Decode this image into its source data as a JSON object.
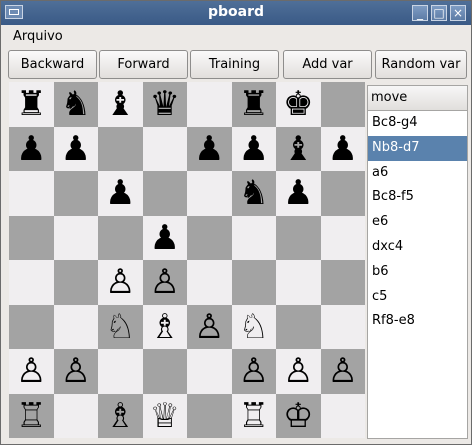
{
  "window": {
    "title": "pboard"
  },
  "menu": {
    "items": [
      "Arquivo"
    ]
  },
  "toolbar": {
    "buttons": [
      "Backward",
      "Forward",
      "Training",
      "Add var",
      "Random var"
    ]
  },
  "board": {
    "light_color": "#f0eef0",
    "dark_color": "#a3a3a3",
    "pieces": [
      [
        "♜",
        "♞",
        "♝",
        "♛",
        "",
        "♜",
        "♚",
        ""
      ],
      [
        "♟",
        "♟",
        "",
        "",
        "♟",
        "♟",
        "♝",
        "♟"
      ],
      [
        "",
        "",
        "♟",
        "",
        "",
        "♞",
        "♟",
        ""
      ],
      [
        "",
        "",
        "",
        "♟",
        "",
        "",
        "",
        ""
      ],
      [
        "",
        "",
        "♙",
        "♙",
        "",
        "",
        "",
        ""
      ],
      [
        "",
        "",
        "♘",
        "♗",
        "♙",
        "♘",
        "",
        ""
      ],
      [
        "♙",
        "♙",
        "",
        "",
        "",
        "♙",
        "♙",
        "♙"
      ],
      [
        "♖",
        "",
        "♗",
        "♕",
        "",
        "♖",
        "♔",
        ""
      ]
    ]
  },
  "moves": {
    "header": "move",
    "items": [
      "Bc8-g4",
      "Nb8-d7",
      "a6",
      "Bc8-f5",
      "e6",
      "dxc4",
      "b6",
      "c5",
      "Rf8-e8"
    ],
    "selected_index": 1,
    "selected_color": "#5a82ad"
  }
}
